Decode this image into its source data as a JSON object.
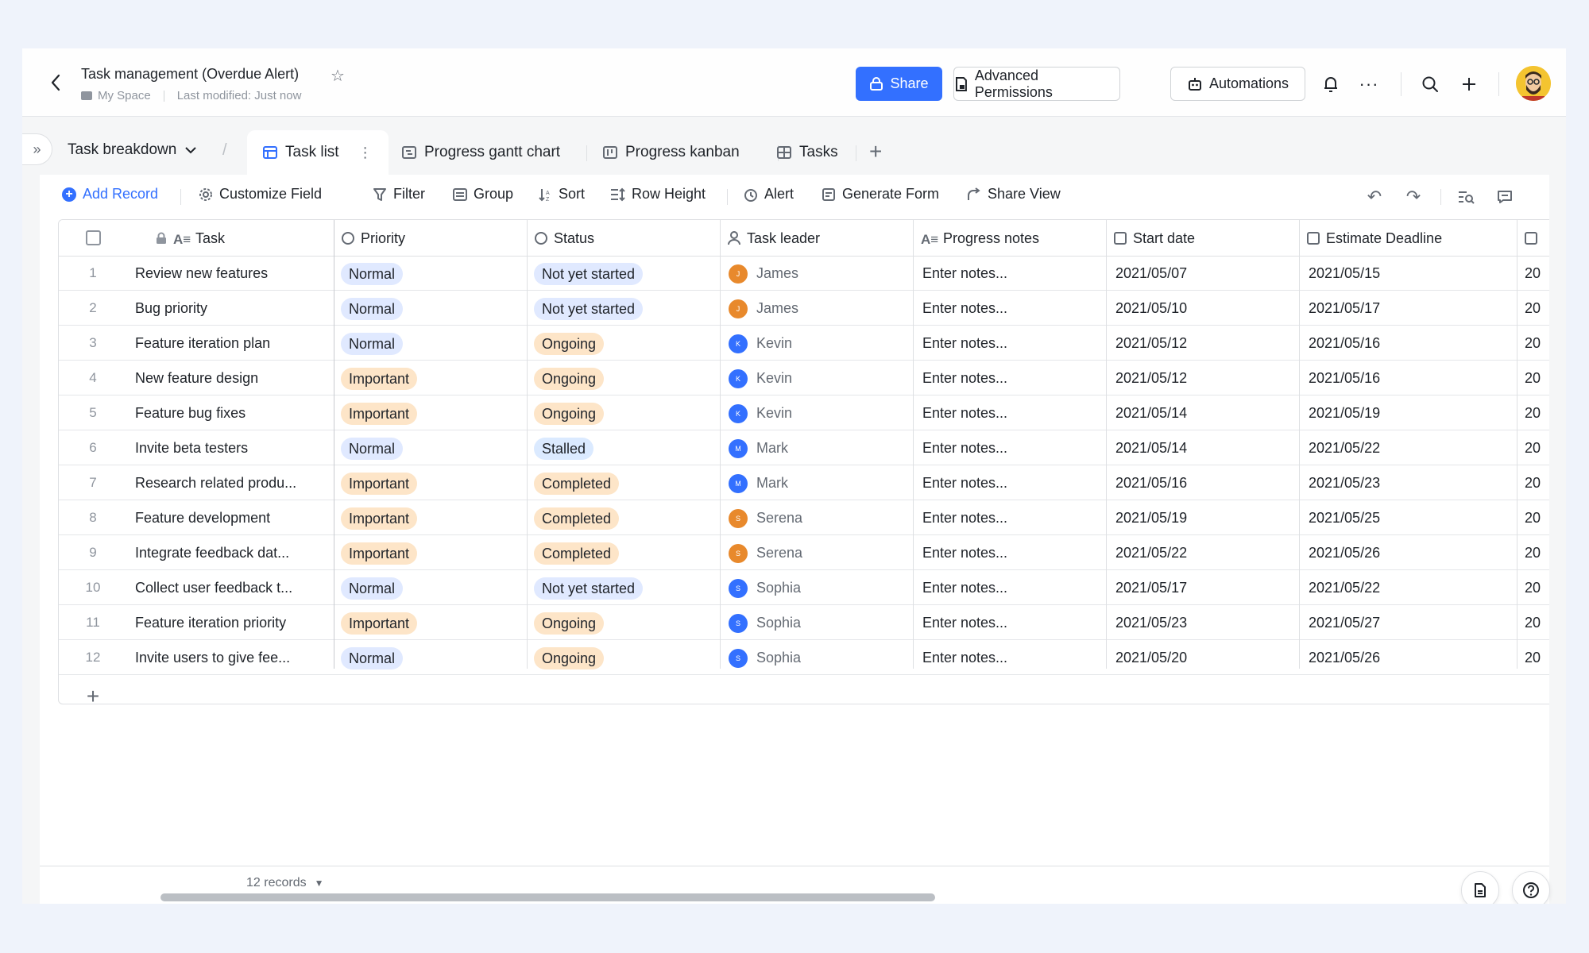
{
  "header": {
    "title": "Task management (Overdue Alert)",
    "location": "My Space",
    "last_modified": "Last modified: Just now",
    "share_label": "Share",
    "permissions_label": "Advanced Permissions",
    "automations_label": "Automations"
  },
  "tabs": {
    "table_name": "Task breakdown",
    "items": [
      {
        "label": "Task list"
      },
      {
        "label": "Progress gantt chart"
      },
      {
        "label": "Progress kanban"
      },
      {
        "label": "Tasks"
      }
    ]
  },
  "toolbar": {
    "add_record": "Add Record",
    "customize_field": "Customize Field",
    "filter": "Filter",
    "group": "Group",
    "sort": "Sort",
    "row_height": "Row Height",
    "alert": "Alert",
    "generate_form": "Generate Form",
    "share_view": "Share View"
  },
  "columns": {
    "task": "Task",
    "priority": "Priority",
    "status": "Status",
    "leader": "Task leader",
    "notes": "Progress notes",
    "start": "Start date",
    "deadline": "Estimate Deadline"
  },
  "rows": [
    {
      "num": "1",
      "task": "Review new features",
      "priority": "Normal",
      "status": "Not yet started",
      "leader": "James",
      "initial": "J",
      "notes": "Enter notes...",
      "start": "2021/05/07",
      "deadline": "2021/05/15",
      "extra": "20"
    },
    {
      "num": "2",
      "task": "Bug priority",
      "priority": "Normal",
      "status": "Not yet started",
      "leader": "James",
      "initial": "J",
      "notes": "Enter notes...",
      "start": "2021/05/10",
      "deadline": "2021/05/17",
      "extra": "20"
    },
    {
      "num": "3",
      "task": "Feature iteration plan",
      "priority": "Normal",
      "status": "Ongoing",
      "leader": "Kevin",
      "initial": "K",
      "notes": "Enter notes...",
      "start": "2021/05/12",
      "deadline": "2021/05/16",
      "extra": "20"
    },
    {
      "num": "4",
      "task": "New feature design",
      "priority": "Important",
      "status": "Ongoing",
      "leader": "Kevin",
      "initial": "K",
      "notes": "Enter notes...",
      "start": "2021/05/12",
      "deadline": "2021/05/16",
      "extra": "20"
    },
    {
      "num": "5",
      "task": "Feature bug fixes",
      "priority": "Important",
      "status": "Ongoing",
      "leader": "Kevin",
      "initial": "K",
      "notes": "Enter notes...",
      "start": "2021/05/14",
      "deadline": "2021/05/19",
      "extra": "20"
    },
    {
      "num": "6",
      "task": "Invite beta testers",
      "priority": "Normal",
      "status": "Stalled",
      "leader": "Mark",
      "initial": "M",
      "notes": "Enter notes...",
      "start": "2021/05/14",
      "deadline": "2021/05/22",
      "extra": "20"
    },
    {
      "num": "7",
      "task": "Research related produ...",
      "priority": "Important",
      "status": "Completed",
      "leader": "Mark",
      "initial": "M",
      "notes": "Enter notes...",
      "start": "2021/05/16",
      "deadline": "2021/05/23",
      "extra": "20"
    },
    {
      "num": "8",
      "task": "Feature development",
      "priority": "Important",
      "status": "Completed",
      "leader": "Serena",
      "initial": "S",
      "notes": "Enter notes...",
      "start": "2021/05/19",
      "deadline": "2021/05/25",
      "extra": "20"
    },
    {
      "num": "9",
      "task": "Integrate feedback dat...",
      "priority": "Important",
      "status": "Completed",
      "leader": "Serena",
      "initial": "S",
      "notes": "Enter notes...",
      "start": "2021/05/22",
      "deadline": "2021/05/26",
      "extra": "20"
    },
    {
      "num": "10",
      "task": "Collect user feedback t...",
      "priority": "Normal",
      "status": "Not yet started",
      "leader": "Sophia",
      "initial": "S",
      "notes": "Enter notes...",
      "start": "2021/05/17",
      "deadline": "2021/05/22",
      "extra": "20"
    },
    {
      "num": "11",
      "task": "Feature iteration priority",
      "priority": "Important",
      "status": "Ongoing",
      "leader": "Sophia",
      "initial": "S",
      "notes": "Enter notes...",
      "start": "2021/05/23",
      "deadline": "2021/05/27",
      "extra": "20"
    },
    {
      "num": "12",
      "task": "Invite users to give fee...",
      "priority": "Normal",
      "status": "Ongoing",
      "leader": "Sophia",
      "initial": "S",
      "notes": "Enter notes...",
      "start": "2021/05/20",
      "deadline": "2021/05/26",
      "extra": "20"
    }
  ],
  "footer": {
    "records": "12 records"
  },
  "colors": {
    "accent": "#3370ff",
    "avatar_orange": "#e8892c",
    "avatar_blue": "#3370ff"
  }
}
